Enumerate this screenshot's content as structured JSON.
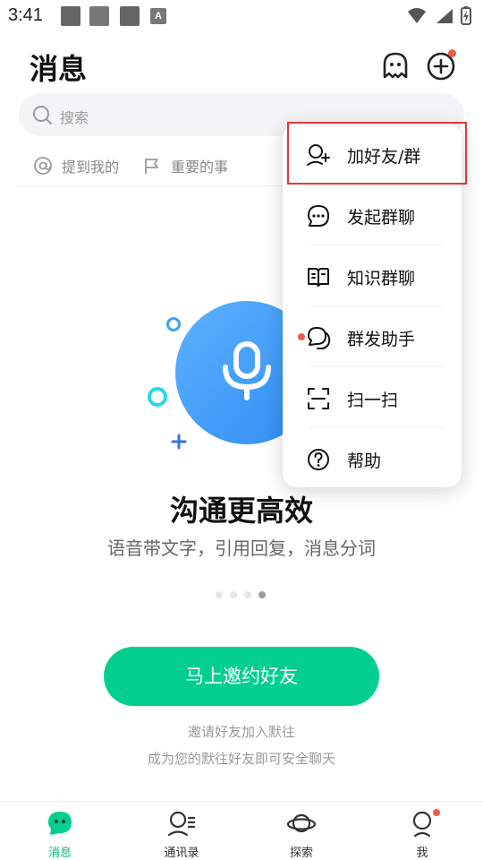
{
  "status_bar": {
    "time": "3:41",
    "badge_letter": "A"
  },
  "header": {
    "title": "消息"
  },
  "search": {
    "placeholder": "搜索"
  },
  "filters": [
    {
      "label": "提到我的"
    },
    {
      "label": "重要的事"
    }
  ],
  "hero": {
    "headline": "沟通更高效",
    "subline": "语音带文字，引用回复，消息分词",
    "pager": {
      "count": 4,
      "active_index": 3
    }
  },
  "invite": {
    "button_label": "马上邀约好友",
    "note_line1": "邀请好友加入默往",
    "note_line2": "成为您的默往好友即可安全聊天"
  },
  "popup_menu": {
    "items": [
      {
        "label": "加好友/群",
        "icon": "add-contact-icon",
        "highlighted": true
      },
      {
        "label": "发起群聊",
        "icon": "chat-bubble-icon"
      },
      {
        "label": "知识群聊",
        "icon": "book-icon"
      },
      {
        "label": "群发助手",
        "icon": "broadcast-icon",
        "has_badge": true
      },
      {
        "label": "扫一扫",
        "icon": "scan-icon"
      },
      {
        "label": "帮助",
        "icon": "help-icon"
      }
    ]
  },
  "bottom_nav": {
    "tabs": [
      {
        "label": "消息",
        "active": true
      },
      {
        "label": "通讯录"
      },
      {
        "label": "探索"
      },
      {
        "label": "我",
        "has_badge": true
      }
    ]
  },
  "colors": {
    "accent": "#02cf8e",
    "badge": "#f4574b",
    "highlight_border": "#dd3b3b",
    "hero_blue": "#2f8cf2"
  }
}
